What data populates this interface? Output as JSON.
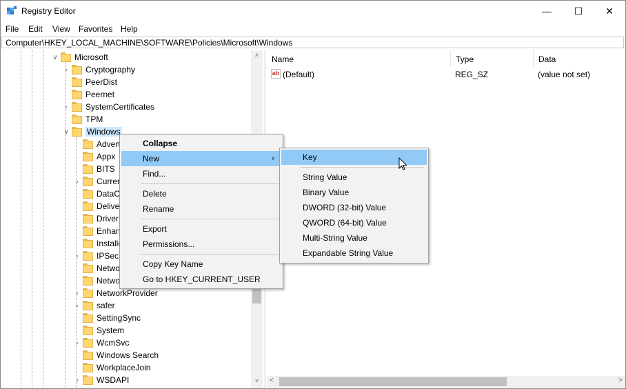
{
  "window": {
    "title": "Registry Editor",
    "minimize": "—",
    "maximize": "☐",
    "close": "✕"
  },
  "menubar": [
    "File",
    "Edit",
    "View",
    "Favorites",
    "Help"
  ],
  "address": "Computer\\HKEY_LOCAL_MACHINE\\SOFTWARE\\Policies\\Microsoft\\Windows",
  "tree": [
    {
      "label": "Microsoft",
      "expanded": true,
      "level": 0
    },
    {
      "label": "Cryptography",
      "expandable": true,
      "level": 1
    },
    {
      "label": "PeerDist",
      "level": 1
    },
    {
      "label": "Peernet",
      "level": 1
    },
    {
      "label": "SystemCertificates",
      "expandable": true,
      "level": 1
    },
    {
      "label": "TPM",
      "level": 1
    },
    {
      "label": "Windows",
      "expanded": true,
      "selected": true,
      "level": 1
    },
    {
      "label": "Advert",
      "level": 2
    },
    {
      "label": "Appx",
      "level": 2
    },
    {
      "label": "BITS",
      "level": 2
    },
    {
      "label": "Currer",
      "expandable": true,
      "level": 2
    },
    {
      "label": "DataC",
      "level": 2
    },
    {
      "label": "Delive",
      "level": 2
    },
    {
      "label": "Driver",
      "level": 2
    },
    {
      "label": "Enhan",
      "level": 2
    },
    {
      "label": "Installe",
      "level": 2
    },
    {
      "label": "IPSec",
      "expandable": true,
      "level": 2
    },
    {
      "label": "Netwo",
      "level": 2
    },
    {
      "label": "Netwo",
      "level": 2
    },
    {
      "label": "NetworkProvider",
      "expandable": true,
      "level": 2
    },
    {
      "label": "safer",
      "expandable": true,
      "level": 2
    },
    {
      "label": "SettingSync",
      "level": 2
    },
    {
      "label": "System",
      "level": 2
    },
    {
      "label": "WcmSvc",
      "expandable": true,
      "level": 2
    },
    {
      "label": "Windows Search",
      "level": 2
    },
    {
      "label": "WorkplaceJoin",
      "level": 2
    },
    {
      "label": "WSDAPI",
      "expandable": true,
      "level": 2
    }
  ],
  "list": {
    "columns": [
      "Name",
      "Type",
      "Data"
    ],
    "rows": [
      {
        "icon": "ab",
        "name": "(Default)",
        "type": "REG_SZ",
        "data": "(value not set)"
      }
    ]
  },
  "context_menu": {
    "items": [
      {
        "label": "Collapse",
        "bold": true
      },
      {
        "label": "New",
        "submenu": "›",
        "highlighted": true
      },
      {
        "label": "Find..."
      },
      {
        "sep": true
      },
      {
        "label": "Delete"
      },
      {
        "label": "Rename"
      },
      {
        "sep": true
      },
      {
        "label": "Export"
      },
      {
        "label": "Permissions..."
      },
      {
        "sep": true
      },
      {
        "label": "Copy Key Name"
      },
      {
        "label": "Go to HKEY_CURRENT_USER"
      }
    ]
  },
  "submenu": {
    "items": [
      {
        "label": "Key",
        "highlighted": true
      },
      {
        "sep": true
      },
      {
        "label": "String Value"
      },
      {
        "label": "Binary Value"
      },
      {
        "label": "DWORD (32-bit) Value"
      },
      {
        "label": "QWORD (64-bit) Value"
      },
      {
        "label": "Multi-String Value"
      },
      {
        "label": "Expandable String Value"
      }
    ]
  },
  "scroll_glyphs": {
    "up": "˄",
    "down": "˅",
    "left": "˂",
    "right": "˃"
  }
}
